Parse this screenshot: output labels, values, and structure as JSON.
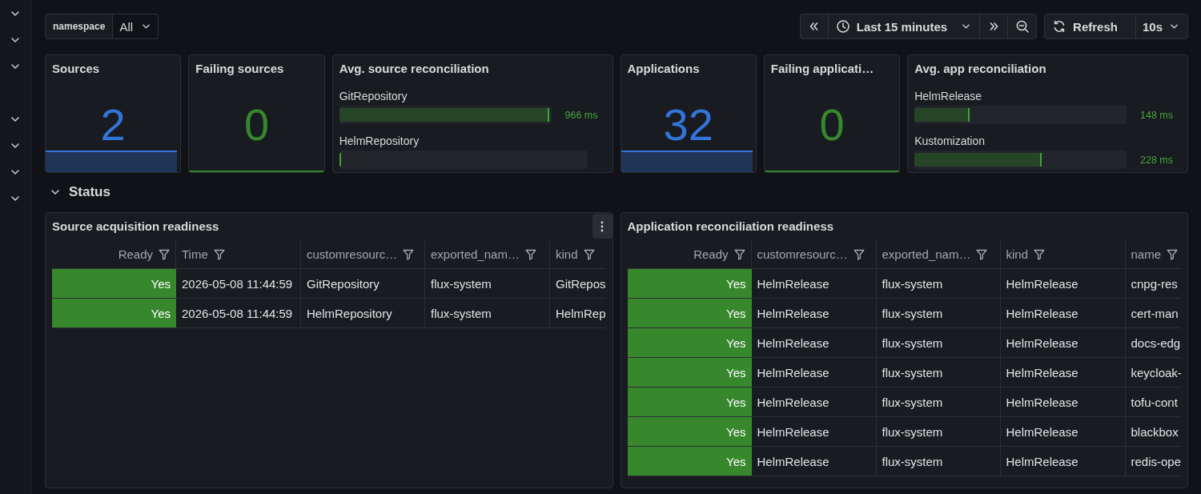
{
  "variables": [
    {
      "label": "namespace",
      "value": "All"
    }
  ],
  "time_picker": {
    "range": "Last 15 minutes"
  },
  "refresh": {
    "label": "Refresh",
    "interval": "10s"
  },
  "stat_panels": [
    {
      "kind": "stat",
      "title": "Sources",
      "value": "2",
      "color": "#3274d9",
      "sparkline_filled": true
    },
    {
      "kind": "stat",
      "title": "Failing sources",
      "value": "0",
      "color": "#37872d",
      "sparkline_filled": false
    },
    {
      "kind": "bar_gauge",
      "title": "Avg. source reconciliation",
      "bars": [
        {
          "label": "GitRepository",
          "level": 0.99,
          "value": "966 ms"
        },
        {
          "label": "HelmRepository",
          "level": 0
        }
      ]
    },
    {
      "kind": "stat",
      "title": "Applications",
      "value": "32",
      "color": "#3274d9",
      "sparkline_filled": true
    },
    {
      "kind": "stat",
      "title": "Failing applicati…",
      "value": "0",
      "color": "#37872d",
      "sparkline_filled": false
    },
    {
      "kind": "bar_gauge",
      "title": "Avg. app reconciliation",
      "bars": [
        {
          "label": "HelmRelease",
          "level": 0.26,
          "value": "148 ms"
        },
        {
          "label": "Kustomization",
          "level": 0.6,
          "value": "228 ms"
        }
      ]
    }
  ],
  "row": {
    "title": "Status",
    "expanded": true
  },
  "tables": [
    {
      "title": "Source acquisition readiness",
      "show_menu": true,
      "columns": [
        {
          "label": "Ready",
          "kind": "status"
        },
        {
          "label": "Time",
          "kind": "text"
        },
        {
          "label": "customresourc…",
          "kind": "text"
        },
        {
          "label": "exported_nam…",
          "kind": "text"
        },
        {
          "label": "kind",
          "kind": "text"
        }
      ],
      "rows": [
        [
          "Yes",
          "2026-05-08 11:44:59",
          "GitRepository",
          "flux-system",
          "GitRepos"
        ],
        [
          "Yes",
          "2026-05-08 11:44:59",
          "HelmRepository",
          "flux-system",
          "HelmRep"
        ]
      ]
    },
    {
      "title": "Application reconciliation readiness",
      "show_menu": false,
      "columns": [
        {
          "label": "Ready",
          "kind": "status"
        },
        {
          "label": "customresourc…",
          "kind": "text"
        },
        {
          "label": "exported_nam…",
          "kind": "text"
        },
        {
          "label": "kind",
          "kind": "text"
        },
        {
          "label": "name",
          "kind": "text"
        }
      ],
      "rows": [
        [
          "Yes",
          "HelmRelease",
          "flux-system",
          "HelmRelease",
          "cnpg-res"
        ],
        [
          "Yes",
          "HelmRelease",
          "flux-system",
          "HelmRelease",
          "cert-man"
        ],
        [
          "Yes",
          "HelmRelease",
          "flux-system",
          "HelmRelease",
          "docs-edg"
        ],
        [
          "Yes",
          "HelmRelease",
          "flux-system",
          "HelmRelease",
          "keycloak-"
        ],
        [
          "Yes",
          "HelmRelease",
          "flux-system",
          "HelmRelease",
          "tofu-cont"
        ],
        [
          "Yes",
          "HelmRelease",
          "flux-system",
          "HelmRelease",
          "blackbox"
        ],
        [
          "Yes",
          "HelmRelease",
          "flux-system",
          "HelmRelease",
          "redis-ope"
        ]
      ]
    }
  ]
}
